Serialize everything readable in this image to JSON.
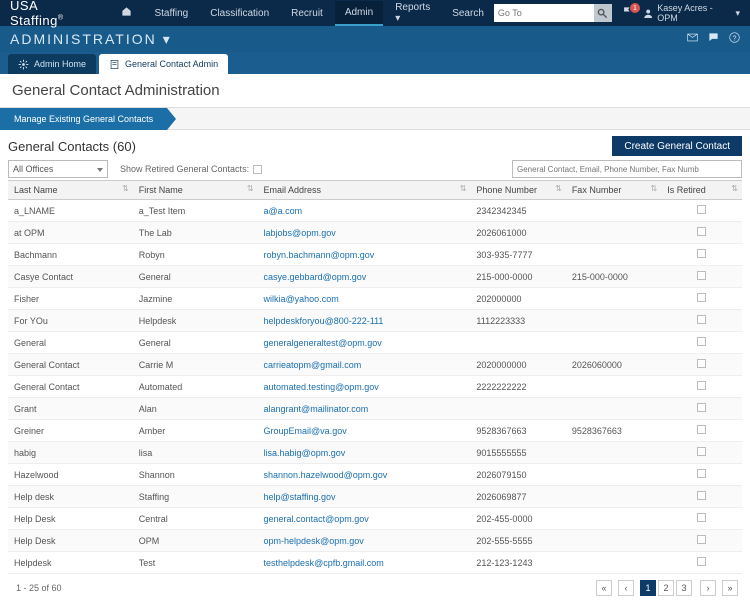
{
  "brand": "USA Staffing",
  "brandReg": "®",
  "nav": {
    "items": [
      {
        "label": "",
        "icon": "home"
      },
      {
        "label": "Staffing"
      },
      {
        "label": "Classification"
      },
      {
        "label": "Recruit"
      },
      {
        "label": "Admin",
        "active": true
      },
      {
        "label": "Reports",
        "caret": true
      },
      {
        "label": "Search"
      }
    ]
  },
  "goto": {
    "placeholder": "Go To"
  },
  "notifications": {
    "count": "1"
  },
  "user": {
    "name": "Kasey Acres - OPM"
  },
  "subheader": {
    "title": "ADMINISTRATION"
  },
  "tabs": [
    {
      "label": "Admin Home",
      "icon": "gear",
      "style": "dark"
    },
    {
      "label": "General Contact Admin",
      "icon": "doc",
      "style": "light"
    }
  ],
  "page": {
    "title": "General Contact Administration"
  },
  "ribbon": {
    "label": "Manage Existing General Contacts"
  },
  "section": {
    "title": "General Contacts (60)"
  },
  "createBtn": "Create General Contact",
  "officeSelect": "All Offices",
  "showRetired": "Show Retired General Contacts:",
  "filterPlaceholder": "General Contact, Email, Phone Number, Fax Numb",
  "columns": [
    {
      "key": "last",
      "label": "Last Name"
    },
    {
      "key": "first",
      "label": "First Name"
    },
    {
      "key": "email",
      "label": "Email Address"
    },
    {
      "key": "phone",
      "label": "Phone Number"
    },
    {
      "key": "fax",
      "label": "Fax Number"
    },
    {
      "key": "retired",
      "label": "Is Retired"
    }
  ],
  "rows": [
    {
      "last": "a_LNAME",
      "first": "a_Test Item",
      "email": "a@a.com",
      "phone": "2342342345",
      "fax": "",
      "retired": false
    },
    {
      "last": "at OPM",
      "first": "The Lab",
      "email": "labjobs@opm.gov",
      "phone": "2026061000",
      "fax": "",
      "retired": false
    },
    {
      "last": "Bachmann",
      "first": "Robyn",
      "email": "robyn.bachmann@opm.gov",
      "phone": "303-935-7777",
      "fax": "",
      "retired": false
    },
    {
      "last": "Casye Contact",
      "first": "General",
      "email": "casye.gebbard@opm.gov",
      "phone": "215-000-0000",
      "fax": "215-000-0000",
      "retired": false
    },
    {
      "last": "Fisher",
      "first": "Jazmine",
      "email": "wilkia@yahoo.com",
      "phone": "202000000",
      "fax": "",
      "retired": false
    },
    {
      "last": "For YOu",
      "first": "Helpdesk",
      "email": "helpdeskforyou@800-222-111",
      "phone": "1112223333",
      "fax": "",
      "retired": false
    },
    {
      "last": "General",
      "first": "General",
      "email": "generalgeneraltest@opm.gov",
      "phone": "",
      "fax": "",
      "retired": false
    },
    {
      "last": "General Contact",
      "first": "Carrie M",
      "email": "carrieatopm@gmail.com",
      "phone": "2020000000",
      "fax": "2026060000",
      "retired": false
    },
    {
      "last": "General Contact",
      "first": "Automated",
      "email": "automated.testing@opm.gov",
      "phone": "2222222222",
      "fax": "",
      "retired": false
    },
    {
      "last": "Grant",
      "first": "Alan",
      "email": "alangrant@mailinator.com",
      "phone": "",
      "fax": "",
      "retired": false
    },
    {
      "last": "Greiner",
      "first": "Amber",
      "email": "GroupEmail@va.gov",
      "phone": "9528367663",
      "fax": "9528367663",
      "retired": false
    },
    {
      "last": "habig",
      "first": "lisa",
      "email": "lisa.habig@opm.gov",
      "phone": "9015555555",
      "fax": "",
      "retired": false
    },
    {
      "last": "Hazelwood",
      "first": "Shannon",
      "email": "shannon.hazelwood@opm.gov",
      "phone": "2026079150",
      "fax": "",
      "retired": false
    },
    {
      "last": "Help desk",
      "first": "Staffing",
      "email": "help@staffing.gov",
      "phone": "2026069877",
      "fax": "",
      "retired": false
    },
    {
      "last": "Help Desk",
      "first": "Central",
      "email": "general.contact@opm.gov",
      "phone": "202-455-0000",
      "fax": "",
      "retired": false
    },
    {
      "last": "Help Desk",
      "first": "OPM",
      "email": "opm-helpdesk@opm.gov",
      "phone": "202-555-5555",
      "fax": "",
      "retired": false
    },
    {
      "last": "Helpdesk",
      "first": "Test",
      "email": "testhelpdesk@cpfb.gmail.com",
      "phone": "212-123-1243",
      "fax": "",
      "retired": false
    }
  ],
  "pager": {
    "info": "1 - 25 of 60",
    "pages": [
      "1",
      "2",
      "3"
    ]
  }
}
